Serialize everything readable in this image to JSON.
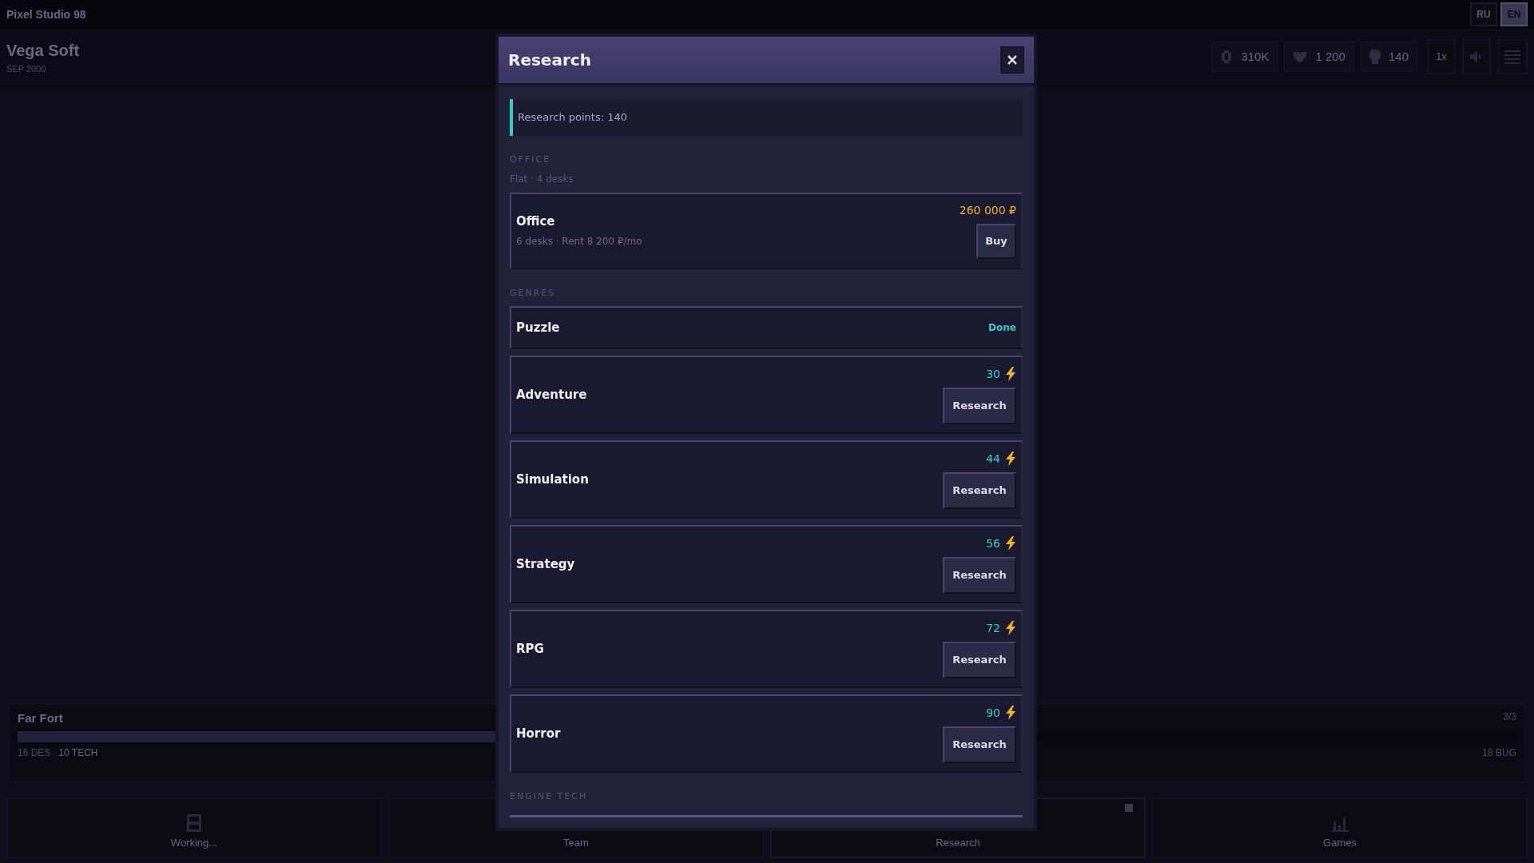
{
  "window": {
    "title": "Pixel Studio 98"
  },
  "languages": [
    {
      "label": "RU",
      "selected": false
    },
    {
      "label": "EN",
      "selected": true
    }
  ],
  "company": {
    "name": "Vega Soft",
    "date": "SEP 2000"
  },
  "stats": [
    {
      "kind": "money",
      "value": "310K"
    },
    {
      "kind": "fans",
      "value": "1 200"
    },
    {
      "kind": "research",
      "value": "140"
    }
  ],
  "speed_button": "1x",
  "project": {
    "name": "Far Fort",
    "level": 0.45,
    "design": "16 DES",
    "tech": "10 TECH",
    "count": "3/3",
    "bugs": "18 BUG"
  },
  "nav": [
    {
      "kind": "working",
      "label": "Working...",
      "badge": false
    },
    {
      "kind": "team",
      "label": "Team",
      "badge": false
    },
    {
      "kind": "research",
      "label": "Research",
      "badge": true
    },
    {
      "kind": "games",
      "label": "Games",
      "badge": false
    }
  ],
  "dialog": {
    "title": "Research",
    "points": "Research points: 140",
    "sections": [
      {
        "heading": "OFFICE",
        "note": "Flat · 4 desks",
        "items": [
          {
            "kind": "purchase",
            "name": "Office",
            "detail": "6 desks · Rent 8 200 ₽/mo",
            "price": "260 000 ₽",
            "action": "Buy"
          }
        ]
      },
      {
        "heading": "GENRES",
        "items": [
          {
            "kind": "done",
            "name": "Puzzle",
            "status": "Done"
          },
          {
            "kind": "research",
            "name": "Adventure",
            "cost": "30",
            "action": "Research"
          },
          {
            "kind": "research",
            "name": "Simulation",
            "cost": "44",
            "action": "Research"
          },
          {
            "kind": "research",
            "name": "Strategy",
            "cost": "56",
            "action": "Research"
          },
          {
            "kind": "research",
            "name": "RPG",
            "cost": "72",
            "action": "Research"
          },
          {
            "kind": "research",
            "name": "Horror",
            "cost": "90",
            "action": "Research"
          }
        ]
      },
      {
        "heading": "ENGINE TECH"
      }
    ]
  }
}
